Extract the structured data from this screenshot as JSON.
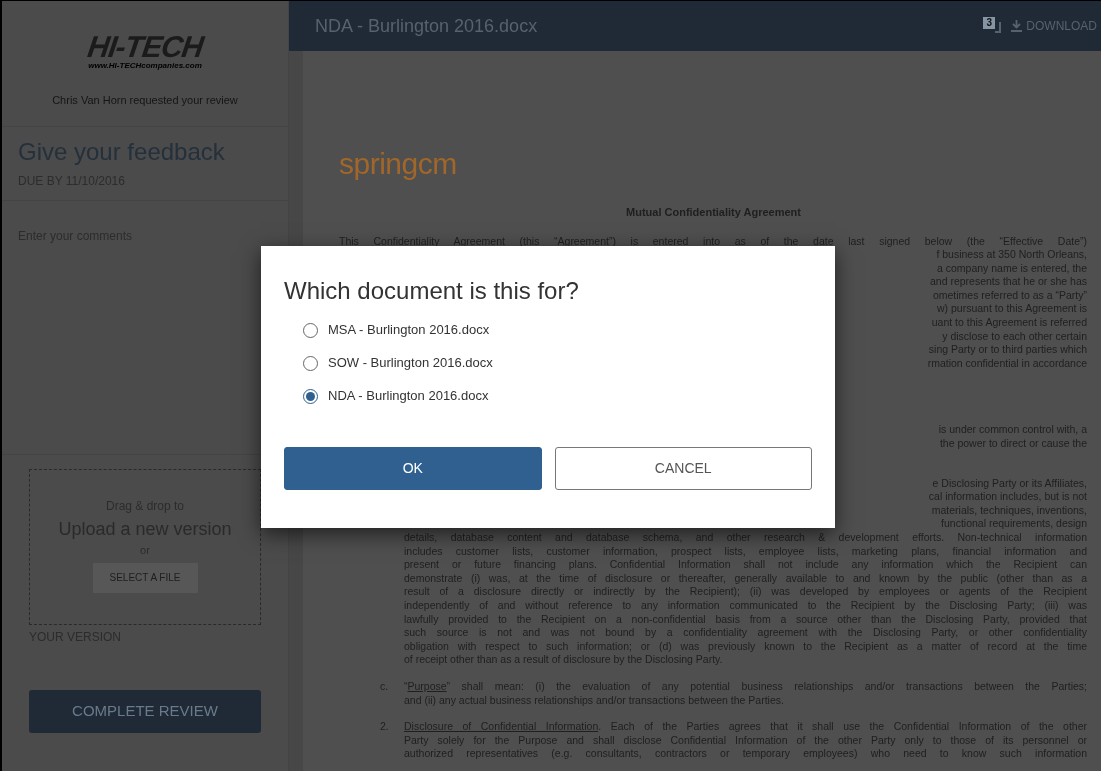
{
  "sidebar": {
    "logo": {
      "wordmark": "HI-TECH",
      "url": "www.HI-TECHcompanies.com"
    },
    "request_note": "Chris Van Horn requested your review",
    "feedback": {
      "heading": "Give your feedback",
      "due": "DUE BY 11/10/2016"
    },
    "comments": {
      "placeholder": "Enter your comments"
    },
    "upload": {
      "hint": "Drag & drop to",
      "title": "Upload a new version",
      "or": "or",
      "button": "SELECT A FILE"
    },
    "version_label": "YOUR VERSION",
    "complete_button": "COMPLETE REVIEW"
  },
  "header": {
    "title": "NDA - Burlington 2016.docx",
    "version_count": "3",
    "download": "DOWNLOAD"
  },
  "document": {
    "logo": "springcm",
    "title": "Mutual Confidentiality Agreement",
    "paragraphs": [
      {
        "lines": [
          {
            "kind": "full",
            "text": "This Confidentiality Agreement (this “Agreement”) is entered into as of the date last signed below (the “Effective Date”)"
          },
          {
            "kind": "fragment",
            "text": "f business at 350 North Orleans,"
          },
          {
            "kind": "fragment",
            "text": "a company name is entered, the"
          },
          {
            "kind": "fragment",
            "text": "and represents that he or she has"
          },
          {
            "kind": "fragment",
            "text": "ometimes referred to as a “Party”"
          },
          {
            "kind": "fragment",
            "text": "w) pursuant to this Agreement is"
          },
          {
            "kind": "fragment",
            "text": "uant to this Agreement is referred"
          },
          {
            "kind": "fragment",
            "text": "y disclose to each other certain"
          },
          {
            "kind": "fragment",
            "text": "sing Party or to third parties which"
          },
          {
            "kind": "fragment",
            "text": "rmation confidential in accordance"
          }
        ]
      },
      {
        "lines": [
          {
            "kind": "fragment",
            "text": "is under common control with, a"
          },
          {
            "kind": "fragment",
            "text": "the power to direct or cause the"
          }
        ]
      },
      {
        "lines": [
          {
            "kind": "fragment",
            "text": "e Disclosing Party or its Affiliates,"
          },
          {
            "kind": "fragment",
            "text": "cal information includes, but is not"
          },
          {
            "kind": "fragment",
            "text": "materials, techniques, inventions,"
          },
          {
            "kind": "fragment",
            "text": "functional requirements, design"
          },
          {
            "kind": "indented",
            "text": "details, database content and database schema, and other research & development efforts. Non-technical information"
          },
          {
            "kind": "indented",
            "text": "includes customer lists, customer information, prospect lists, employee lists, marketing plans, financial information and"
          },
          {
            "kind": "indented",
            "text": "present or future financing plans. Confidential Information shall not include any information which the Recipient can"
          },
          {
            "kind": "indented",
            "text": "demonstrate (i) was, at the time of disclosure or thereafter, generally available to and known by the public (other than as a"
          },
          {
            "kind": "indented",
            "text": "result of a disclosure directly or indirectly by the Recipient); (ii) was developed by employees or agents of the Recipient"
          },
          {
            "kind": "indented",
            "text": "independently of and without reference to any information communicated to the Recipient by the Disclosing Party; (iii) was"
          },
          {
            "kind": "indented",
            "text": "lawfully provided to the Recipient on a non-confidential basis from a source other than the Disclosing Party, provided that"
          },
          {
            "kind": "indented",
            "text": "such source is not and was not bound by a confidentiality agreement with the Disclosing Party, or other confidentiality"
          },
          {
            "kind": "indented",
            "text": "obligation with respect to such information; or (d) was previously known to the Recipient as a matter of record at the time"
          },
          {
            "kind": "last",
            "text": "of receipt other than as a result of disclosure by the Disclosing Party."
          }
        ]
      },
      {
        "marker": "c.",
        "lines": [
          {
            "kind": "indented",
            "parts": [
              {
                "text": "“"
              },
              {
                "text": "Purpose",
                "underline": true
              },
              {
                "text": "” shall mean: (i) the evaluation of any potential business relationships and/or transactions between the Parties;"
              }
            ]
          },
          {
            "kind": "last",
            "text": "and (ii) any actual business relationships and/or transactions between the Parties."
          }
        ]
      },
      {
        "marker": "2.",
        "lines": [
          {
            "kind": "indented",
            "parts": [
              {
                "text": "Disclosure of Confidential Information",
                "underline": true
              },
              {
                "text": ". Each of the Parties agrees that it shall use the Confidential Information of the other"
              }
            ]
          },
          {
            "kind": "indented",
            "text": "Party solely for the Purpose and shall disclose Confidential Information of the other Party only to those of its personnel or"
          },
          {
            "kind": "indented",
            "text": "authorized representatives (e.g. consultants, contractors or temporary employees) who need to know such information"
          }
        ]
      }
    ]
  },
  "dialog": {
    "title": "Which document is this for?",
    "options": [
      {
        "label": "MSA - Burlington 2016.docx",
        "selected": false
      },
      {
        "label": "SOW - Burlington 2016.docx",
        "selected": false
      },
      {
        "label": "NDA - Burlington 2016.docx",
        "selected": true
      }
    ],
    "buttons": [
      {
        "label": "OK",
        "kind": "primary"
      },
      {
        "label": "CANCEL",
        "kind": "secondary"
      }
    ]
  }
}
